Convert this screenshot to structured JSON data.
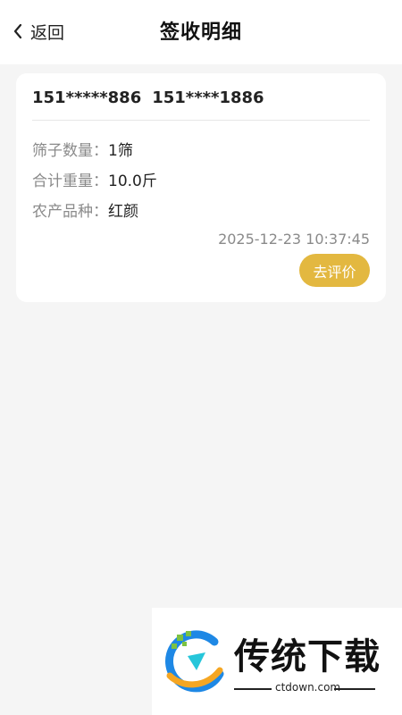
{
  "header": {
    "back_label": "返回",
    "title": "签收明细"
  },
  "card": {
    "phone_masked": "151*****886",
    "phone_partial": "151****1886",
    "rows": [
      {
        "label": "筛子数量：",
        "value": "1筛"
      },
      {
        "label": "合计重量：",
        "value": "10.0斤"
      },
      {
        "label": "农产品种：",
        "value": "红颜"
      }
    ],
    "timestamp": "2025-12-23 10:37:45",
    "action_label": "去评价"
  },
  "watermark": {
    "brand": "传统下载",
    "url": "ctdown.com"
  },
  "colors": {
    "accent": "#e3b840",
    "background": "#f5f5f5"
  },
  "icons": {
    "back": "chevron-left-icon",
    "logo": "ctdown-logo-icon"
  }
}
